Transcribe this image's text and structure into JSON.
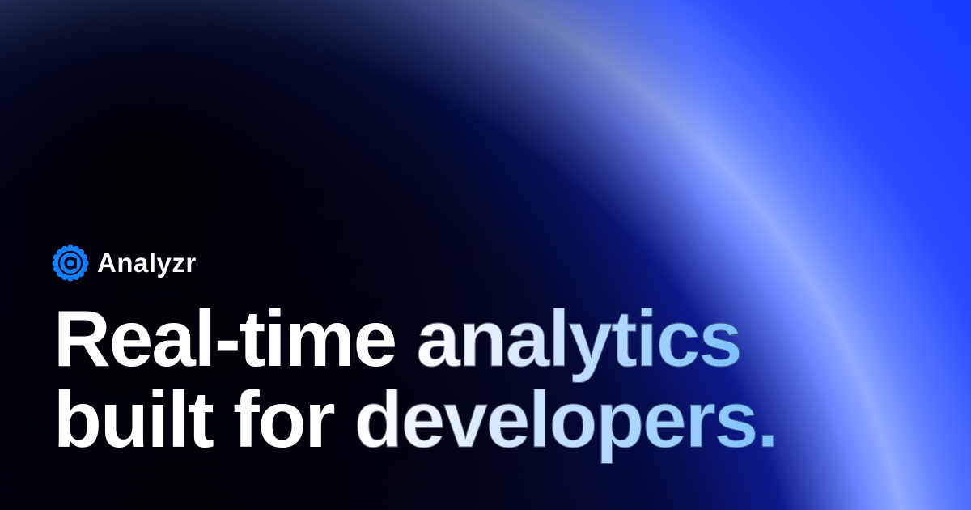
{
  "brand": {
    "name": "Analyzr",
    "logo_icon": "at-sign-badge-icon",
    "logo_color": "#1580ff"
  },
  "headline": {
    "line1_plain": "Real-time ",
    "line1_highlight": "analytics",
    "line2_plain": "built for ",
    "line2_highlight": "developers."
  },
  "colors": {
    "background_dark": "#000000",
    "glow": "#8faaff",
    "accent_blue": "#1a3cff",
    "highlight_end": "#7cc0ff"
  }
}
